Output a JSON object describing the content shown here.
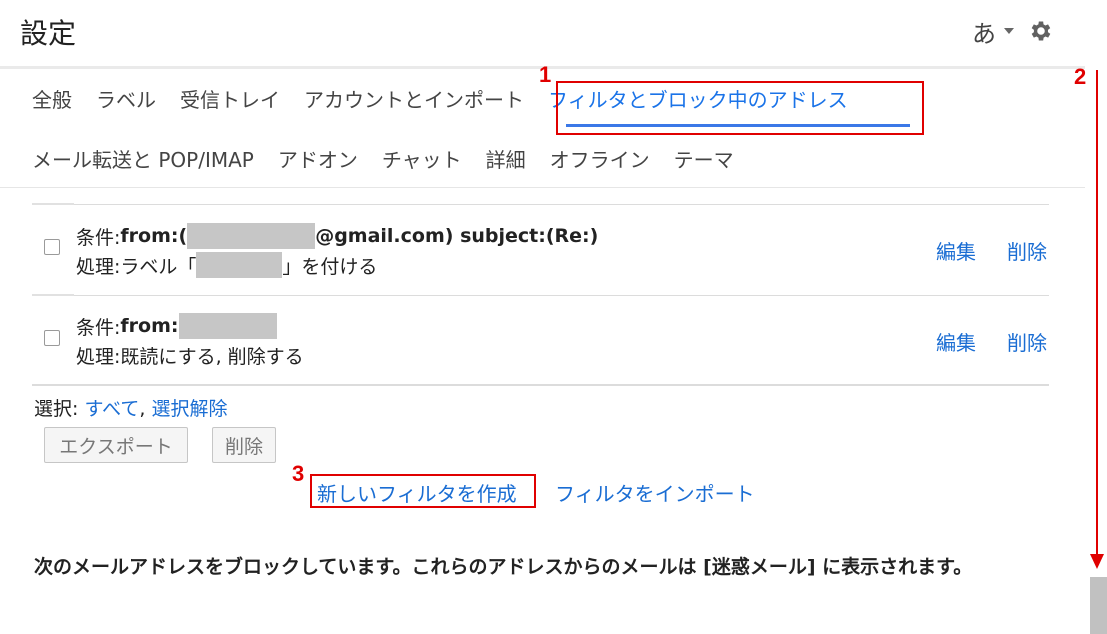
{
  "header": {
    "title": "設定",
    "input_tool_char": "あ"
  },
  "tabs": {
    "row1": [
      "全般",
      "ラベル",
      "受信トレイ",
      "アカウントとインポート"
    ],
    "active": "フィルタとブロック中のアドレス",
    "row2": [
      "メール転送と POP/IMAP",
      "アドオン",
      "チャット",
      "詳細",
      "オフライン",
      "テーマ"
    ]
  },
  "filters": [
    {
      "condition_label": "条件: ",
      "condition_from": "from:(",
      "condition_rest": "@gmail.com) subject:(Re:)",
      "action_label": "処理: ",
      "action_pre": "ラベル「",
      "action_post": "」を付ける",
      "edit": "編集",
      "delete": "削除"
    },
    {
      "condition_label": "条件: ",
      "condition_from": "from:",
      "action_label": "処理: ",
      "action_text": "既読にする, 削除する",
      "edit": "編集",
      "delete": "削除"
    }
  ],
  "selection": {
    "label": "選択: ",
    "all": "すべて",
    "separator": ", ",
    "none": "選択解除"
  },
  "buttons": {
    "export": "エクスポート",
    "delete": "削除"
  },
  "links": {
    "new_filter": "新しいフィルタを作成",
    "import_filter": "フィルタをインポート"
  },
  "block_text": "次のメールアドレスをブロックしています。これらのアドレスからのメールは [迷惑メール] に表示されます。",
  "annotations": [
    "1",
    "2",
    "3"
  ],
  "colors": {
    "link": "#1a6dd3",
    "active_tab": "#1a73e8",
    "annotation": "#e00000"
  }
}
